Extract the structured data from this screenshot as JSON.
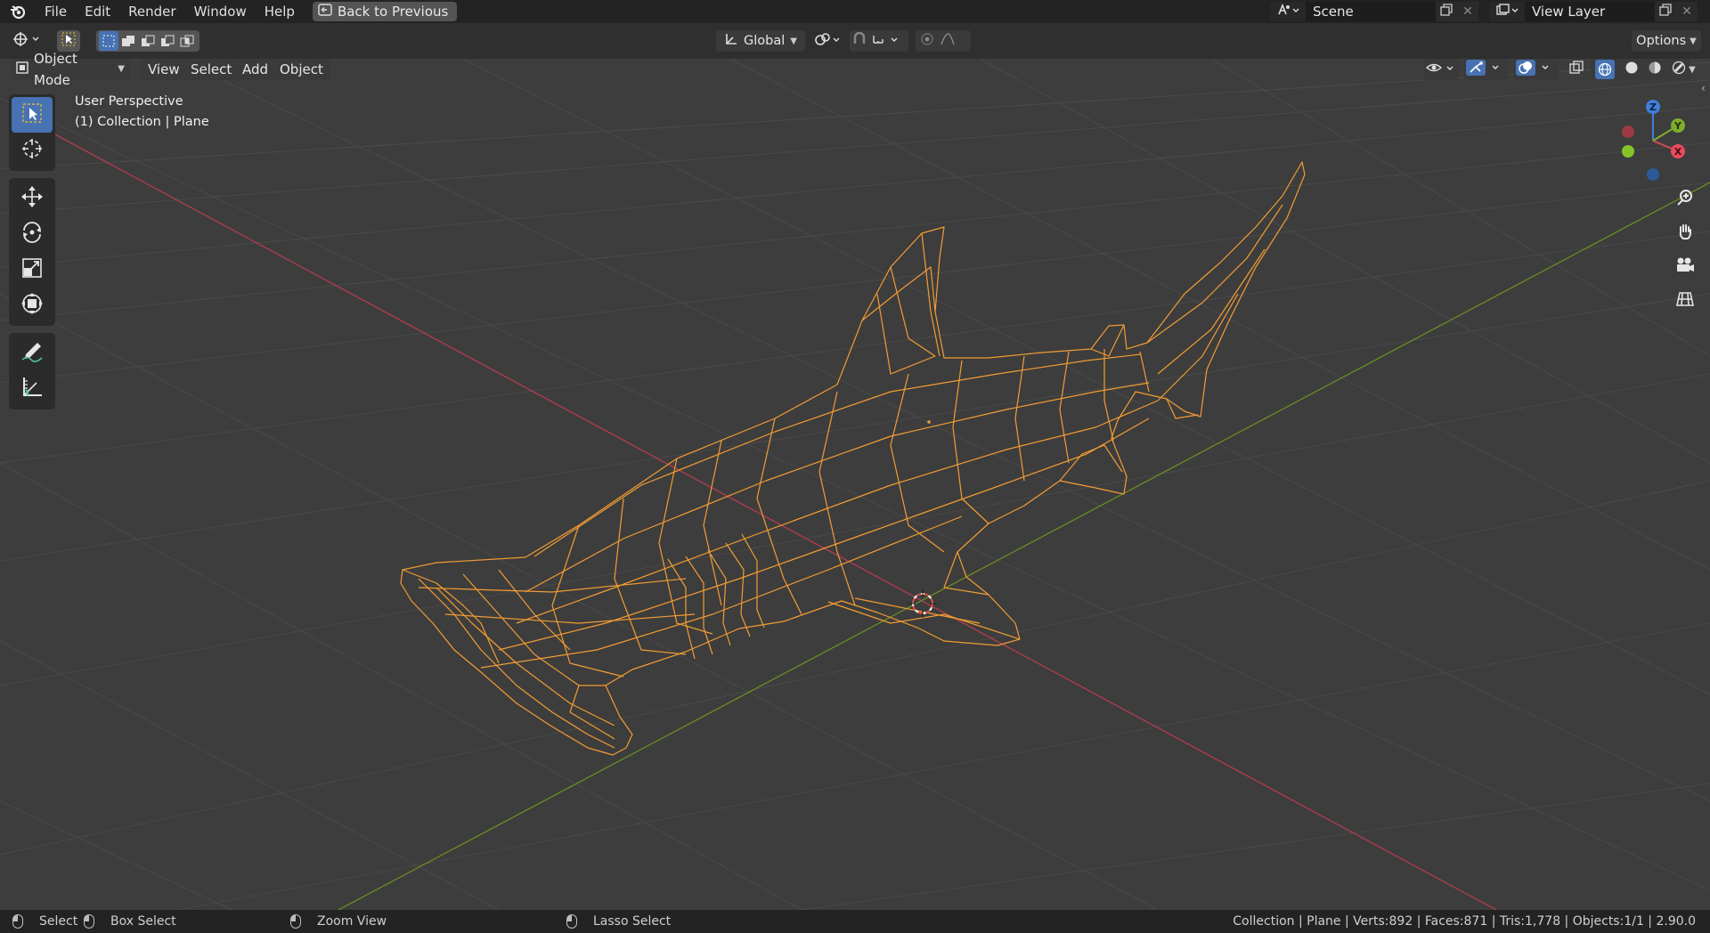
{
  "menubar": {
    "items": [
      "File",
      "Edit",
      "Render",
      "Window",
      "Help"
    ],
    "back_button": "Back to Previous",
    "scene_name": "Scene",
    "view_layer_name": "View Layer"
  },
  "toolheader": {
    "transform_orientation": "Global",
    "options_label": "Options"
  },
  "viewheader": {
    "mode": "Object Mode",
    "menus": [
      "View",
      "Select",
      "Add",
      "Object"
    ]
  },
  "viewport": {
    "perspective_label": "User Perspective",
    "collection_label": "(1) Collection | Plane",
    "gizmo_axes": {
      "x": "X",
      "y": "Y",
      "z": "Z"
    }
  },
  "statusbar": {
    "select": "Select",
    "box_select": "Box Select",
    "zoom_view": "Zoom View",
    "lasso_select": "Lasso Select",
    "stats": "Collection | Plane | Verts:892 | Faces:871 | Tris:1,778 | Objects:1/1 | 2.90.0"
  },
  "colors": {
    "selection_orange": "#f29c33",
    "x_axis": "#b53d4c",
    "y_axis": "#6a8e23",
    "active_blue": "#4772b3",
    "header_bg": "#2f2f2f",
    "viewport_bg": "#3d3d3d"
  },
  "icons": {
    "toolbar": [
      "select-box-icon",
      "cursor-icon",
      "move-icon",
      "rotate-icon",
      "scale-icon",
      "transform-icon",
      "annotate-icon",
      "measure-icon"
    ],
    "nav": [
      "zoom-icon",
      "pan-hand-icon",
      "camera-icon",
      "ortho-grid-icon"
    ]
  }
}
